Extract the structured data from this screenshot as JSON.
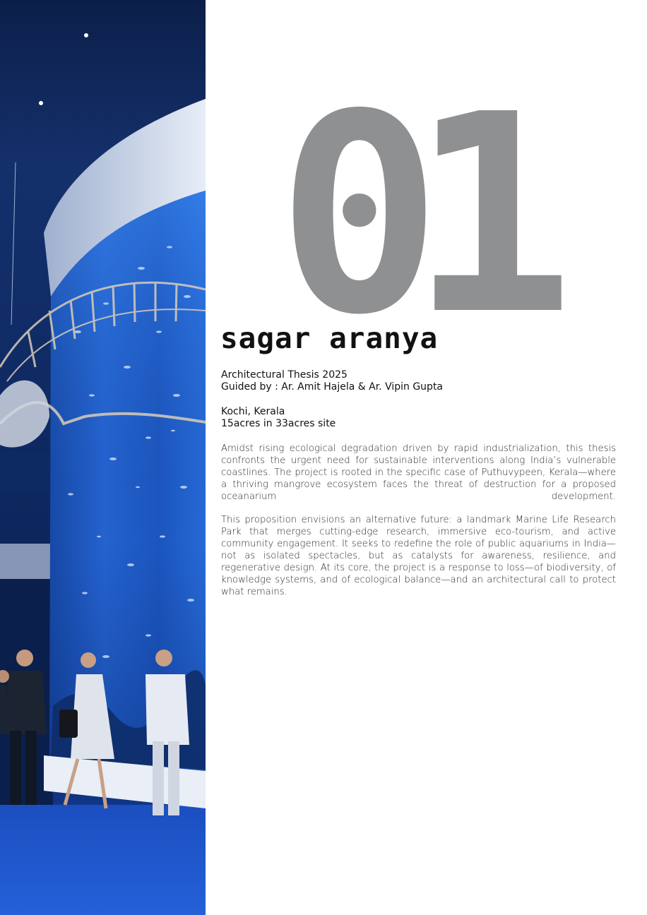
{
  "project": {
    "number": "01",
    "title": "sagar aranya"
  },
  "meta": {
    "thesis": "Architectural Thesis 2025",
    "guided_by": "Guided by : Ar. Amit Hajela & Ar. Vipin Gupta",
    "location": "Kochi, Kerala",
    "site_area": "15acres in 33acres site"
  },
  "description": {
    "paragraph_1": "Amidst rising ecological degradation driven by rapid industrialization, this thesis confronts the urgent need for sustainable interventions along India’s vulnerable coastlines. The project is rooted in the specific case of Puthuvypeen, Kerala—where a thriving mangrove ecosystem faces the threat of destruction for a proposed oceanarium development.",
    "paragraph_2": "This proposition envisions an alternative future: a landmark Marine Life Research Park that merges cutting-edge research, immersive eco-tourism, and active community engagement. It seeks to redefine the role of public aquariums in India—not as isolated spectacles, but as catalysts for awareness, resilience, and regenerative design. At its core, the project is a response to loss—of biodiversity, of knowledge systems, and of ecological balance—and an architectural call to protect what remains."
  },
  "colors": {
    "number_grey": "#8f9091",
    "title_black": "#111111",
    "aquarium_blue": "#1f5fd0",
    "floor_blue": "#1f56c8"
  }
}
